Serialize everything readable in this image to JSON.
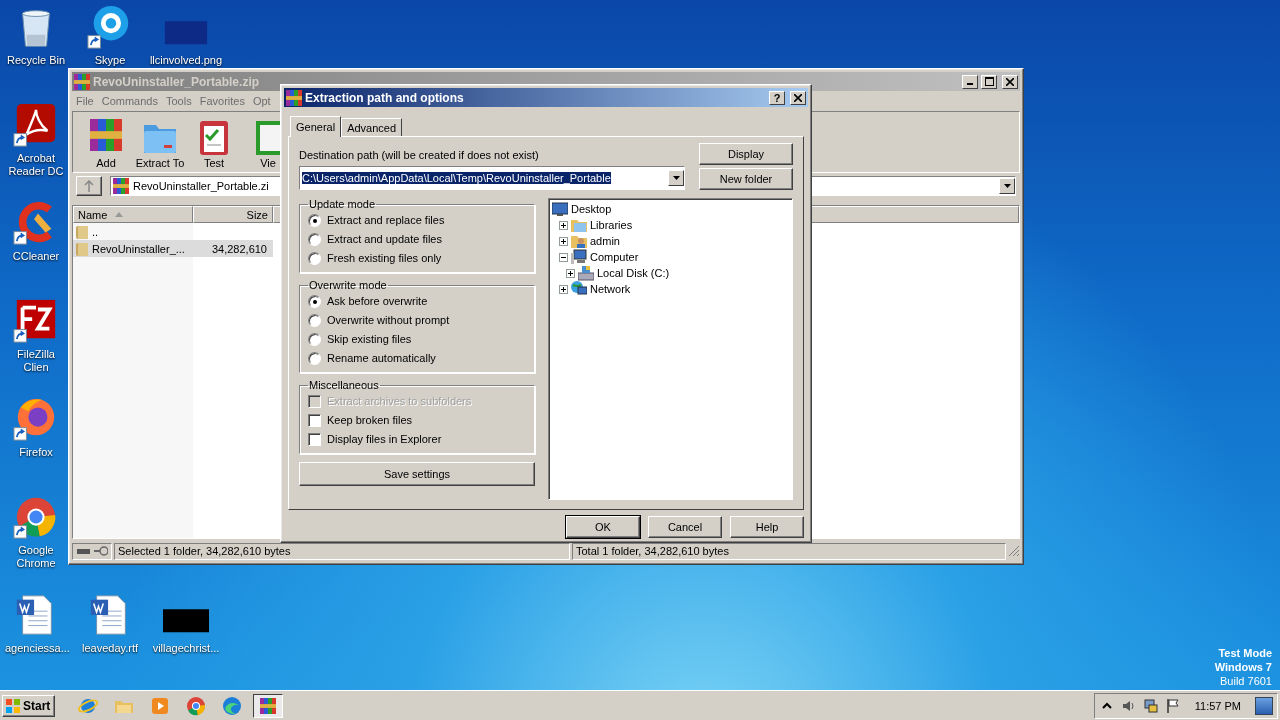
{
  "desktop": {
    "icons": [
      {
        "label": "Recycle Bin",
        "kind": "recycle",
        "shortcut": false
      },
      {
        "label": "Skype",
        "kind": "skype",
        "shortcut": true
      },
      {
        "label": "llcinvolved.png",
        "kind": "image",
        "shortcut": false
      },
      {
        "label": "Acrobat Reader DC",
        "kind": "acrobat",
        "shortcut": true
      },
      {
        "label": "CCleaner",
        "kind": "ccleaner",
        "shortcut": true
      },
      {
        "label": "FileZilla Clien",
        "kind": "filezilla",
        "shortcut": true
      },
      {
        "label": "Firefox",
        "kind": "firefox",
        "shortcut": true
      },
      {
        "label": "Google Chrome",
        "kind": "chrome",
        "shortcut": true
      },
      {
        "label": "agenciessa...",
        "kind": "word",
        "shortcut": false
      },
      {
        "label": "leaveday.rtf",
        "kind": "word",
        "shortcut": false
      },
      {
        "label": "villagechrist...",
        "kind": "redacted",
        "shortcut": false
      }
    ],
    "os_notice": [
      "Test Mode",
      "Windows 7",
      "Build 7601"
    ]
  },
  "archive_window": {
    "title": "RevoUninstaller_Portable.zip",
    "menu": [
      "File",
      "Commands",
      "Tools",
      "Favorites",
      "Opt"
    ],
    "toolbar": [
      {
        "label": "Add",
        "kind": "add"
      },
      {
        "label": "Extract To",
        "kind": "extract"
      },
      {
        "label": "Test",
        "kind": "test"
      },
      {
        "label": "Vie",
        "kind": "view"
      }
    ],
    "address": "RevoUninstaller_Portable.zi",
    "columns": [
      "Name",
      "Size"
    ],
    "rows": [
      {
        "name": "..",
        "selected": false
      },
      {
        "name": "RevoUninstaller_...",
        "size": "34,282,610",
        "selected": true
      }
    ],
    "status": [
      "Selected 1 folder, 34,282,610 bytes",
      "Total 1 folder, 34,282,610 bytes"
    ]
  },
  "dialog": {
    "title": "Extraction path and options",
    "help_glyph": "?",
    "tabs": [
      {
        "label": "General",
        "selected": true
      },
      {
        "label": "Advanced",
        "selected": false
      }
    ],
    "destination": {
      "label": "Destination path (will be created if does not exist)",
      "value": "C:\\Users\\admin\\AppData\\Local\\Temp\\RevoUninstaller_Portable",
      "highlighted": true
    },
    "side_buttons": [
      "Display",
      "New folder"
    ],
    "groups": [
      {
        "title": "Update mode",
        "kind": "radio",
        "options": [
          {
            "label": "Extract and replace files",
            "selected": true
          },
          {
            "label": "Extract and update files",
            "selected": false
          },
          {
            "label": "Fresh existing files only",
            "selected": false
          }
        ]
      },
      {
        "title": "Overwrite mode",
        "kind": "radio",
        "options": [
          {
            "label": "Ask before overwrite",
            "selected": true
          },
          {
            "label": "Overwrite without prompt",
            "selected": false
          },
          {
            "label": "Skip existing files",
            "selected": false
          },
          {
            "label": "Rename automatically",
            "selected": false
          }
        ]
      },
      {
        "title": "Miscellaneous",
        "kind": "checkbox",
        "options": [
          {
            "label": "Extract archives to subfolders",
            "checked": false,
            "disabled": true
          },
          {
            "label": "Keep broken files",
            "checked": false,
            "disabled": false
          },
          {
            "label": "Display files in Explorer",
            "checked": false,
            "disabled": false
          }
        ]
      }
    ],
    "save_button": "Save settings",
    "tree": [
      {
        "label": "Desktop",
        "kind": "desktop",
        "children": [
          {
            "label": "Libraries",
            "kind": "libraries",
            "expanded": false
          },
          {
            "label": "admin",
            "kind": "user",
            "expanded": false
          },
          {
            "label": "Computer",
            "kind": "computer",
            "expanded": true,
            "children": [
              {
                "label": "Local Disk (C:)",
                "kind": "disk",
                "expanded": false
              }
            ]
          },
          {
            "label": "Network",
            "kind": "network",
            "expanded": false
          }
        ]
      }
    ],
    "buttons": [
      {
        "label": "OK",
        "default": true
      },
      {
        "label": "Cancel",
        "default": false
      },
      {
        "label": "Help",
        "default": false
      }
    ]
  },
  "taskbar": {
    "start": "Start",
    "apps": [
      {
        "kind": "ie",
        "selected": false
      },
      {
        "kind": "explorer",
        "selected": false
      },
      {
        "kind": "media",
        "selected": false
      },
      {
        "kind": "chrome",
        "selected": false
      },
      {
        "kind": "edge",
        "selected": false
      },
      {
        "kind": "winrar",
        "selected": true
      }
    ],
    "clock": "11:57 PM"
  }
}
